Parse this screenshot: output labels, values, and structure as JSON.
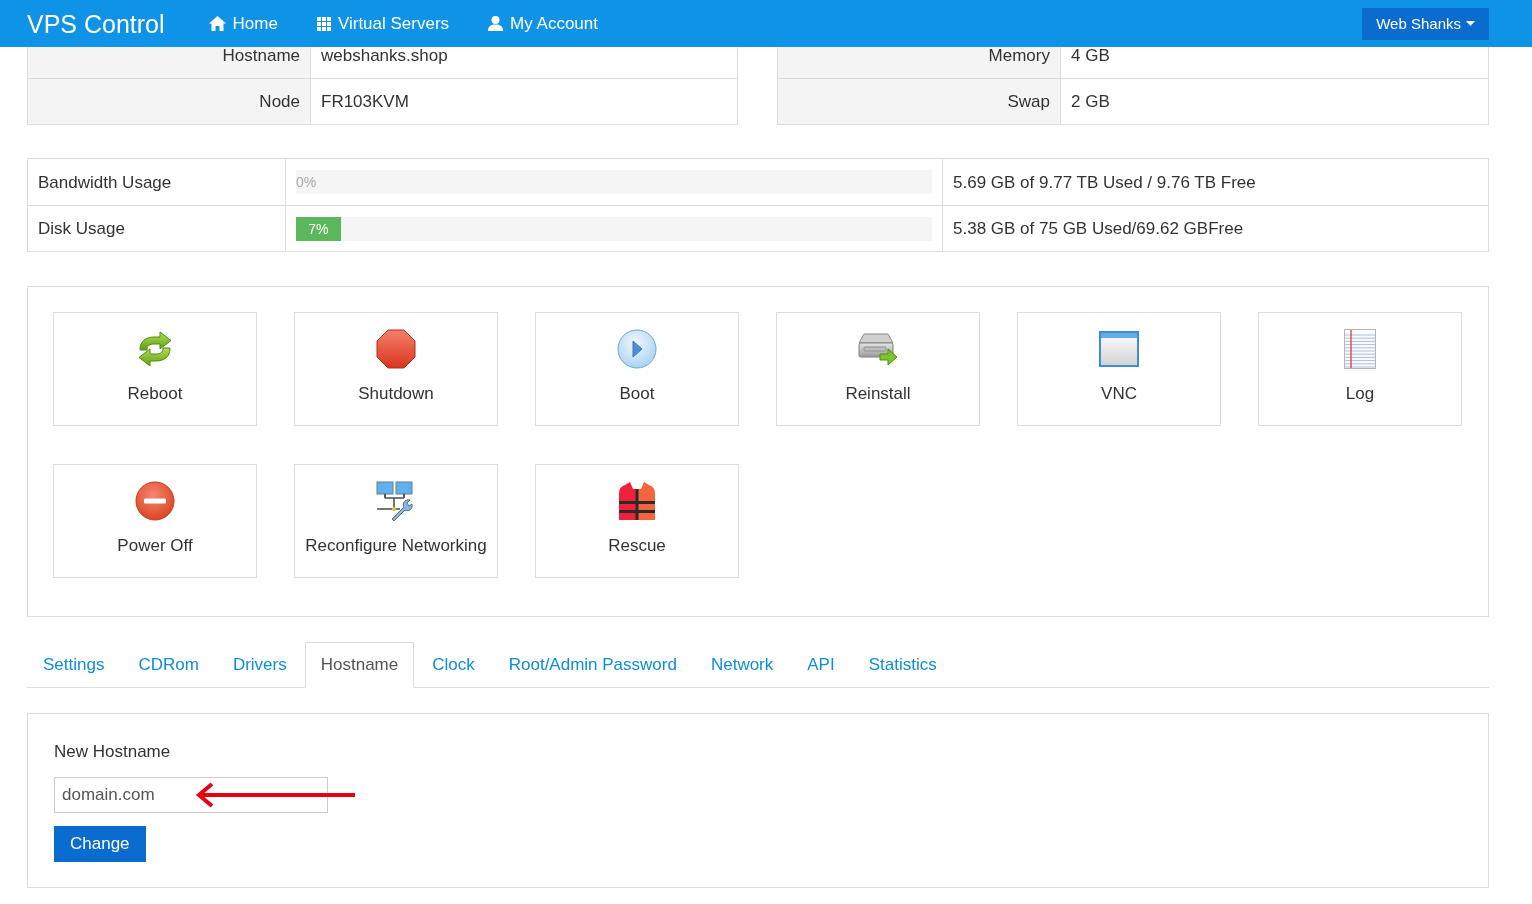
{
  "navbar": {
    "brand": "VPS Control",
    "links": [
      {
        "label": "Home"
      },
      {
        "label": "Virtual Servers"
      },
      {
        "label": "My Account"
      }
    ],
    "user_menu": "Web Shanks"
  },
  "server_info": {
    "left": [
      {
        "label": "Hostname",
        "value": "webshanks.shop"
      },
      {
        "label": "Node",
        "value": "FR103KVM"
      }
    ],
    "right": [
      {
        "label": "Memory",
        "value": "4 GB"
      },
      {
        "label": "Swap",
        "value": "2 GB"
      }
    ]
  },
  "usage": [
    {
      "label": "Bandwidth Usage",
      "bar_text": "0%",
      "reading": "5.69 GB of 9.77 TB Used / 9.76 TB Free"
    },
    {
      "label": "Disk Usage",
      "level": 0.07,
      "bar_text": "7%",
      "reading": "5.38 GB of 75 GB Used/69.62 GBFree"
    }
  ],
  "actions": [
    {
      "label": "Reboot"
    },
    {
      "label": "Shutdown"
    },
    {
      "label": "Boot"
    },
    {
      "label": "Reinstall"
    },
    {
      "label": "VNC"
    },
    {
      "label": "Log"
    },
    {
      "label": "Power Off"
    },
    {
      "label": "Reconfigure Networking"
    },
    {
      "label": "Rescue"
    }
  ],
  "tabs": [
    {
      "label": "Settings",
      "selected": false
    },
    {
      "label": "CDRom",
      "selected": false
    },
    {
      "label": "Drivers",
      "selected": false
    },
    {
      "label": "Hostname",
      "selected": true
    },
    {
      "label": "Clock",
      "selected": false
    },
    {
      "label": "Root/Admin Password",
      "selected": false
    },
    {
      "label": "Network",
      "selected": false
    },
    {
      "label": "API",
      "selected": false
    },
    {
      "label": "Statistics",
      "selected": false
    }
  ],
  "hostname_form": {
    "label": "New Hostname",
    "value": "domain.com",
    "button": "Change"
  }
}
